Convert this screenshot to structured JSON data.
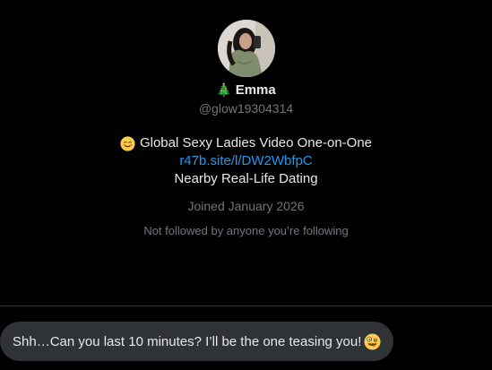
{
  "profile": {
    "name_emoji": "🎄",
    "name": "Emma",
    "handle": "@glow19304314",
    "bio_emoji": "smiling-face-icon",
    "bio_line1": "Global Sexy Ladies Video One-on-One",
    "bio_link": "r47b.site/l/DW2WbfpC",
    "bio_line3": "Nearby Real-Life Dating",
    "joined": "Joined January 2026",
    "followers_note": "Not followed by anyone you’re following"
  },
  "message": {
    "text": "Shh…Can you last 10 minutes? I’ll be the one teasing you!",
    "emoji": "zany-face-icon"
  },
  "colors": {
    "background": "#000000",
    "text_primary": "#e7e9ea",
    "text_secondary": "#71767b",
    "link": "#1d9bf0",
    "bubble": "#2f3336",
    "divider": "#2f3336"
  }
}
